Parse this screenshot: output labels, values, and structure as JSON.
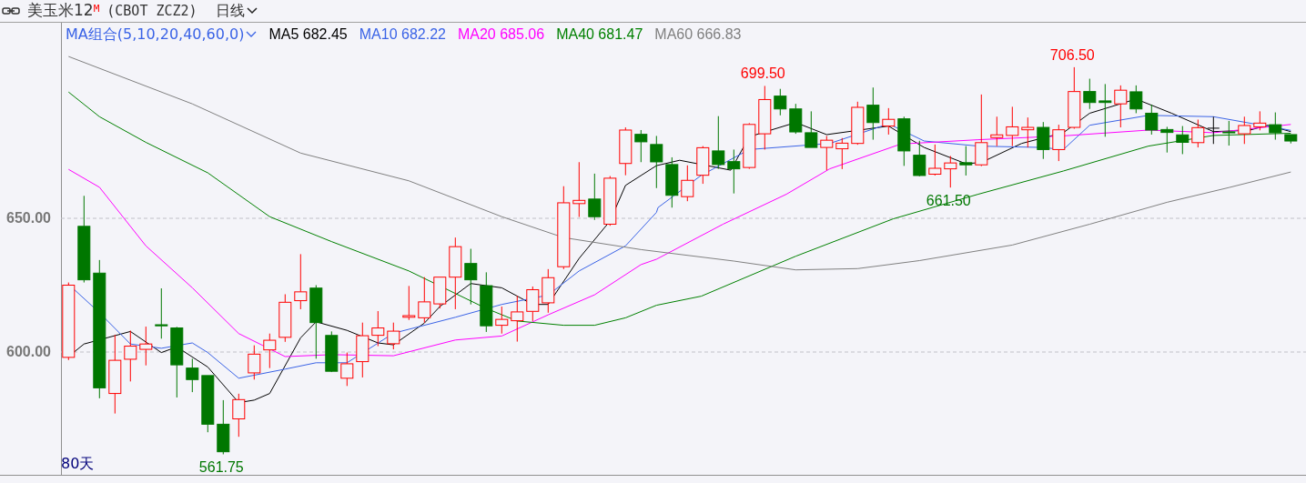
{
  "header": {
    "title": "美玉米12",
    "title_mark": "M",
    "code": "(CBOT ZCZ2)",
    "period": "日线"
  },
  "indicator": {
    "label": "MA组合(5,10,20,40,60,0)",
    "values": [
      {
        "name": "MA5",
        "value": "682.45",
        "color": "#000000"
      },
      {
        "name": "MA10",
        "value": "682.22",
        "color": "#3a63e6"
      },
      {
        "name": "MA20",
        "value": "685.06",
        "color": "#ff00ff"
      },
      {
        "name": "MA40",
        "value": "681.47",
        "color": "#008000"
      },
      {
        "name": "MA60",
        "value": "666.83",
        "color": "#808080"
      }
    ]
  },
  "price_axis": {
    "labels": [
      "650.00",
      "600.00"
    ]
  },
  "chart": {
    "range_label": "80天",
    "annotations": [
      {
        "kind": "high",
        "text": "699.50"
      },
      {
        "kind": "high",
        "text": "706.50"
      },
      {
        "kind": "low",
        "text": "661.50"
      },
      {
        "kind": "low",
        "text": "561.75"
      }
    ]
  }
}
